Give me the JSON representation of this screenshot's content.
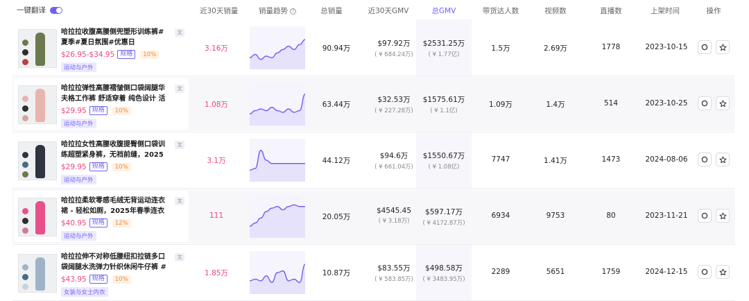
{
  "header": {
    "translate_label": "一键翻译",
    "columns": {
      "sales30": "近30天销量",
      "trend": "销量趋势",
      "total_sales": "总销量",
      "gmv30": "近30天GMV",
      "total_gmv": "总GMV",
      "influencers": "带货达人数",
      "videos": "视频数",
      "lives": "直播数",
      "listed": "上架时间",
      "ops": "操作"
    }
  },
  "colors": {
    "accent": "#6f62f0",
    "price": "#f0457d",
    "pct": "#f08a2c"
  },
  "products": [
    {
      "title": "哈拉拉收腹高腰侧兜塑形训练裤#夏季#夏日氛围#优惠日",
      "price": "$26.95-$34.95",
      "spec": "规格",
      "pct": "10%",
      "category": "运动与户外",
      "sales30": "3.16万",
      "trend": [
        14,
        12,
        15,
        13,
        14,
        11,
        9,
        7,
        9,
        6,
        3
      ],
      "total_sales": "90.94万",
      "gmv30": "$97.92万",
      "gmv30_cny": "( ¥ 684.24万)",
      "total_gmv": "$2531.25万",
      "total_gmv_cny": "( ¥ 1.77亿)",
      "influencers": "1.5万",
      "videos": "2.69万",
      "lives": "1778",
      "listed": "2023-10-15"
    },
    {
      "title": "哈拉拉弹性高腰褶皱侧口袋阔腿华夫格工作裤 舒适穿着 纯色设计 活动自如 ...",
      "price": "$29.95",
      "spec": "规格",
      "pct": "10%",
      "category": "运动与户外",
      "sales30": "1.08万",
      "trend": [
        14,
        12,
        11,
        12,
        10,
        12,
        13,
        11,
        13,
        12,
        2
      ],
      "total_sales": "63.44万",
      "gmv30": "$32.53万",
      "gmv30_cny": "( ¥ 227.28万)",
      "total_gmv": "$1575.61万",
      "total_gmv_cny": "( ¥ 1.1亿)",
      "influencers": "1.09万",
      "videos": "1.4万",
      "lives": "514",
      "listed": "2023-10-25"
    },
    {
      "title": "哈拉拉女性高腰收腹提臀侧口袋训练超塑紧身裤，无裆前缝，2025年夏季穿...",
      "price": "$29.95",
      "spec": "规格",
      "pct": "10%",
      "category": "运动与户外",
      "sales30": "3.1万",
      "trend": [
        14,
        13,
        2,
        8,
        10,
        10,
        10,
        10,
        10,
        10,
        10
      ],
      "total_sales": "44.12万",
      "gmv30": "$94.6万",
      "gmv30_cny": "( ¥ 661.04万)",
      "total_gmv": "$1550.67万",
      "total_gmv_cny": "( ¥ 1.08亿)",
      "influencers": "7747",
      "videos": "1.41万",
      "lives": "1473",
      "listed": "2024-08-06"
    },
    {
      "title": "哈拉拉柔软零感毛绒无背运动连衣裙 - 轻松如厕，2025年春季连衣裙，女士...",
      "price": "$40.95",
      "spec": "规格",
      "pct": "12%",
      "category": "运动与户外",
      "sales30": "111",
      "trend": [
        14,
        12,
        9,
        5,
        3,
        2,
        4,
        2,
        1,
        2,
        2
      ],
      "total_sales": "20.05万",
      "gmv30": "$4545.45",
      "gmv30_cny": "( ¥ 3.18万)",
      "total_gmv": "$597.17万",
      "total_gmv_cny": "( ¥ 4172.87万)",
      "influencers": "6934",
      "videos": "9753",
      "lives": "80",
      "listed": "2023-11-21"
    },
    {
      "title": "哈拉拉伸不对称低腰纽扣拉链多口袋阔腿水洗弹力针织休闲牛仔裤 #夏日氛围...",
      "price": "$43.95",
      "spec": "规格",
      "pct": "10%",
      "category": "女装与女士内衣",
      "sales30": "1.85万",
      "trend": [
        13,
        12,
        13,
        10,
        14,
        8,
        7,
        13,
        12,
        14,
        3
      ],
      "total_sales": "10.87万",
      "gmv30": "$83.55万",
      "gmv30_cny": "( ¥ 583.85万)",
      "total_gmv": "$498.58万",
      "total_gmv_cny": "( ¥ 3483.95万)",
      "influencers": "2289",
      "videos": "5651",
      "lives": "1759",
      "listed": "2024-12-15"
    }
  ]
}
